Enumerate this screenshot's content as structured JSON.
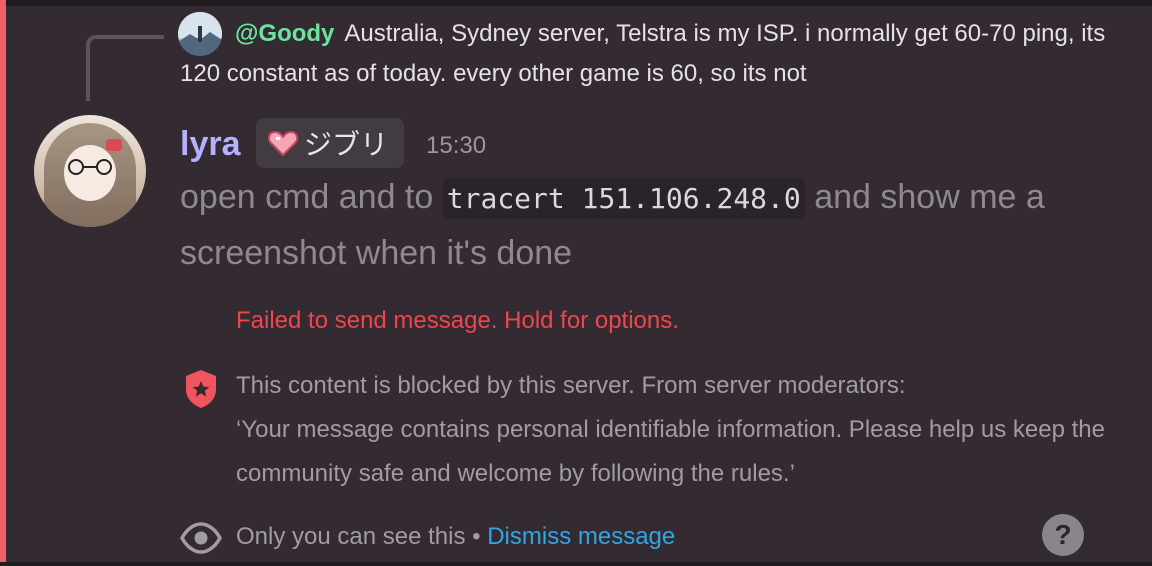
{
  "reply": {
    "mention": "@Goody",
    "text": "Australia, Sydney server, Telstra is my ISP.  i normally get 60-70 ping, its 120 constant as of today. every other game is 60, so its not"
  },
  "message": {
    "username": "lyra",
    "role_label": "ジブリ",
    "timestamp": "15:30",
    "text_before": "open cmd and to ",
    "code": "tracert 151.106.248.0",
    "text_after": " and show me a screenshot when it's done"
  },
  "error": {
    "text": "Failed to send message. Hold for options."
  },
  "blocked": {
    "line1": "This content is blocked by this server. From server moderators:",
    "line2": "‘Your message contains personal identifiable information. Please help us keep the community safe and welcome by following the rules.’"
  },
  "footer": {
    "only_you": "Only you can see this",
    "separator": " • ",
    "dismiss": "Dismiss message",
    "help_glyph": "?"
  },
  "icons": {
    "shield": "shield-star-icon",
    "eye": "eye-icon",
    "help": "question-icon",
    "heart": "heart-icon"
  },
  "colors": {
    "background": "#332b31",
    "accent_bar": "#f05f66",
    "username": "#b7b0ff",
    "mention": "#6ee3a0",
    "error": "#f0454d",
    "link": "#2fa6e6"
  }
}
